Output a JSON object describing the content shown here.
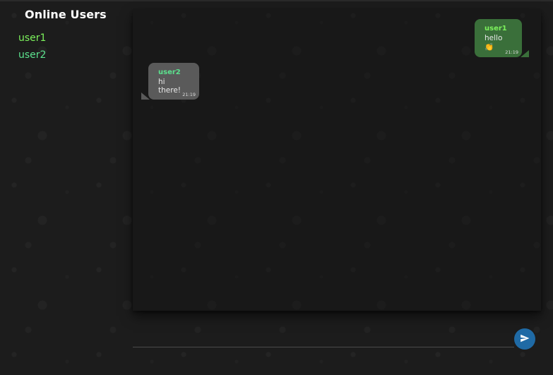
{
  "sidebar": {
    "title": "Online Users",
    "users": [
      {
        "name": "user1",
        "color": "#7cf25c"
      },
      {
        "name": "user2",
        "color": "#5ce28e"
      }
    ]
  },
  "chat": {
    "messages": [
      {
        "sender": "user1",
        "text": "hello 👏",
        "time": "21:19",
        "direction": "sent",
        "bubble_color": "#3a6f3a",
        "sender_color": "#7cf25c"
      },
      {
        "sender": "user2",
        "text": "hi there!",
        "time": "21:19",
        "direction": "received",
        "bubble_color": "#5a5a5a",
        "sender_color": "#5ce28e"
      }
    ]
  },
  "composer": {
    "placeholder": "",
    "send_icon": "send-icon",
    "send_color": "#1f6aa5"
  },
  "colors": {
    "background": "#1c1c1c",
    "title": "#ffffff"
  }
}
